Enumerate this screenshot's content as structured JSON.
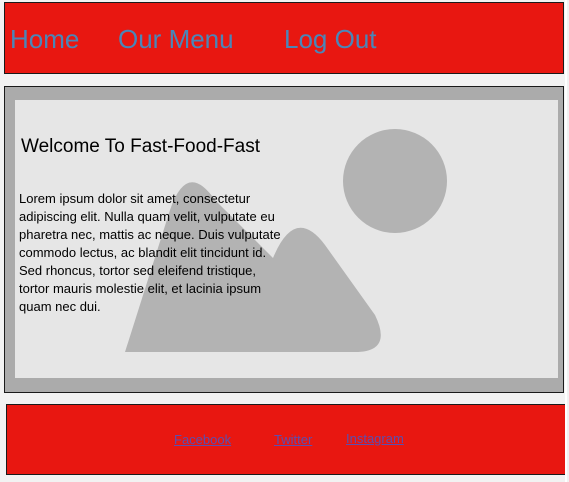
{
  "header": {
    "nav": [
      {
        "label": "Home"
      },
      {
        "label": "Our Menu"
      },
      {
        "label": "Log Out"
      }
    ]
  },
  "hero": {
    "title": "Welcome To Fast-Food-Fast",
    "body": "Lorem ipsum dolor sit amet, consectetur adipiscing elit. Nulla quam velit, vulputate eu pharetra nec, mattis ac neque. Duis vulputate commodo lectus, ac blandit elit tincidunt id. Sed rhoncus, tortor sed eleifend tristique, tortor mauris molestie elit, et lacinia ipsum quam nec dui.",
    "image_icon": "image-placeholder-icon"
  },
  "footer": {
    "links": [
      {
        "label": "Facebook"
      },
      {
        "label": "Twitter"
      },
      {
        "label": "Instagram"
      }
    ]
  },
  "colors": {
    "header_bg": "#e81711",
    "nav_link": "#4a86b8",
    "footer_link": "#5a4fb0",
    "hero_frame": "#ababab",
    "hero_inner": "#e6e6e6"
  }
}
